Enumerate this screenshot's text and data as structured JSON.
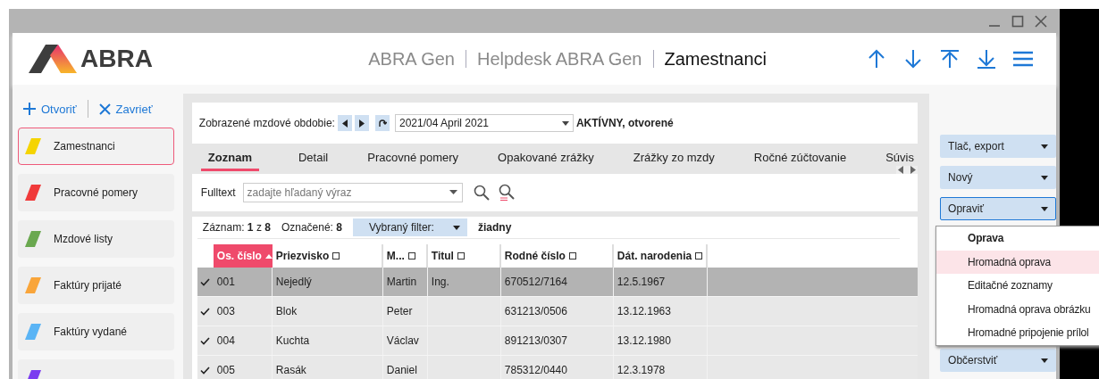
{
  "header": {
    "logo": "ABRA",
    "breadcrumbs": [
      "ABRA Gen",
      "Helpdesk ABRA Gen",
      "Zamestnanci"
    ]
  },
  "sidebar": {
    "actions": [
      "Otvoriť",
      "Zavrieť"
    ],
    "items": [
      {
        "label": "Zamestnanci",
        "color": "#f5d400",
        "selected": true
      },
      {
        "label": "Pracovné pomery",
        "color": "#f03a3a",
        "selected": false
      },
      {
        "label": "Mzdové listy",
        "color": "#6aa84f",
        "selected": false
      },
      {
        "label": "Faktúry prijaté",
        "color": "#f9a53a",
        "selected": false
      },
      {
        "label": "Faktúry vydané",
        "color": "#5ab4f5",
        "selected": false
      },
      {
        "color": "#7b3cf0",
        "selected": false
      }
    ]
  },
  "period": {
    "label": "Zobrazené mzdové obdobie:",
    "value": "2021/04 April 2021",
    "status": "AKTÍVNY, otvorené"
  },
  "tabs": [
    {
      "label": "Zoznam",
      "selected": true
    },
    {
      "label": "Detail",
      "selected": false
    },
    {
      "label": "Pracovné pomery",
      "selected": false
    },
    {
      "label": "Opakované zrážky",
      "selected": false
    },
    {
      "label": "Zrážky zo mzdy",
      "selected": false
    },
    {
      "label": "Ročné zúčtovanie",
      "selected": false
    },
    {
      "label": "Súvis",
      "selected": false
    }
  ],
  "fulltext": {
    "label": "Fulltext",
    "placeholder": "zadajte hľadaný výraz"
  },
  "stats": {
    "record_label": "Záznam:",
    "record": "1",
    "of": "z",
    "total": "8",
    "marked_label": "Označené:",
    "marked": "8",
    "filter_label": "Vybraný filter:",
    "filter_value": "žiadny"
  },
  "table": {
    "columns": [
      {
        "label": "Os. číslo",
        "sorted": true
      },
      {
        "label": "Priezvisko",
        "sorted": false
      },
      {
        "label": "M...",
        "sorted": false
      },
      {
        "label": "Titul",
        "sorted": false
      },
      {
        "label": "Rodné číslo",
        "sorted": false
      },
      {
        "label": "Dát. narodenia",
        "sorted": false
      }
    ],
    "rows": [
      {
        "checked": true,
        "selected": true,
        "cells": [
          "001",
          "Nejedlý",
          "Martin",
          "Ing.",
          "670512/7164",
          "12.5.1967"
        ]
      },
      {
        "checked": true,
        "selected": false,
        "cells": [
          "003",
          "Blok",
          "Peter",
          "",
          "631213/0506",
          "13.12.1963"
        ]
      },
      {
        "checked": true,
        "selected": false,
        "cells": [
          "004",
          "Kuchta",
          "Václav",
          "",
          "891213/0307",
          "13.12.1980"
        ]
      },
      {
        "checked": true,
        "selected": false,
        "cells": [
          "005",
          "Rasák",
          "Daniel",
          "",
          "785312/0440",
          "12.3.1978"
        ]
      }
    ]
  },
  "actions": [
    {
      "label": "Tlač, export",
      "open": false
    },
    {
      "label": "Nový",
      "open": false
    },
    {
      "label": "Opraviť",
      "open": true
    },
    {
      "label": "Občerstviť",
      "open": false
    }
  ],
  "menu": {
    "items": [
      {
        "label": "Oprava",
        "bold": true,
        "selected": false
      },
      {
        "label": "Hromadná oprava",
        "bold": false,
        "selected": true
      },
      {
        "label": "Editačné zoznamy",
        "bold": false,
        "selected": false
      },
      {
        "label": "Hromadná oprava obrázku",
        "bold": false,
        "selected": false
      },
      {
        "label": "Hromadné pripojenie prílol",
        "bold": false,
        "selected": false
      }
    ]
  }
}
